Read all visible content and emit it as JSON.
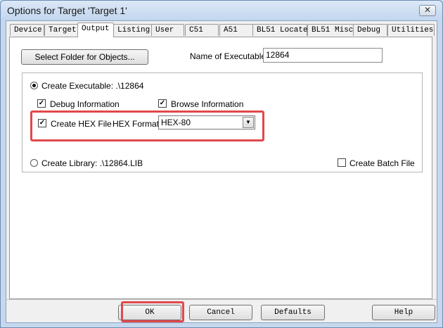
{
  "window": {
    "title": "Options for Target 'Target 1'",
    "close_glyph": "✕"
  },
  "tabs": [
    {
      "label": "Device",
      "active": false
    },
    {
      "label": "Target",
      "active": false
    },
    {
      "label": "Output",
      "active": true
    },
    {
      "label": "Listing",
      "active": false
    },
    {
      "label": "User",
      "active": false
    },
    {
      "label": "C51",
      "active": false
    },
    {
      "label": "A51",
      "active": false
    },
    {
      "label": "BL51 Locate",
      "active": false
    },
    {
      "label": "BL51 Misc",
      "active": false
    },
    {
      "label": "Debug",
      "active": false
    },
    {
      "label": "Utilities",
      "active": false
    }
  ],
  "output": {
    "select_folder_label": "Select Folder for Objects...",
    "name_exec_label": "Name of Executable:",
    "name_exec_value": "12864",
    "create_exec_label": "Create Executable:  .\\12864",
    "debug_info_label": "Debug Information",
    "browse_info_label": "Browse Information",
    "create_hex_label": "Create HEX File",
    "hex_format_label": "HEX Format:",
    "hex_format_value": "HEX-80",
    "create_lib_label": "Create Library:  .\\12864.LIB",
    "create_batch_label": "Create Batch File",
    "check_glyph": "✓",
    "dropdown_glyph": "▼"
  },
  "footer": {
    "ok_label": "OK",
    "cancel_label": "Cancel",
    "defaults_label": "Defaults",
    "help_label": "Help"
  },
  "colors": {
    "highlight": "#e0484c"
  }
}
